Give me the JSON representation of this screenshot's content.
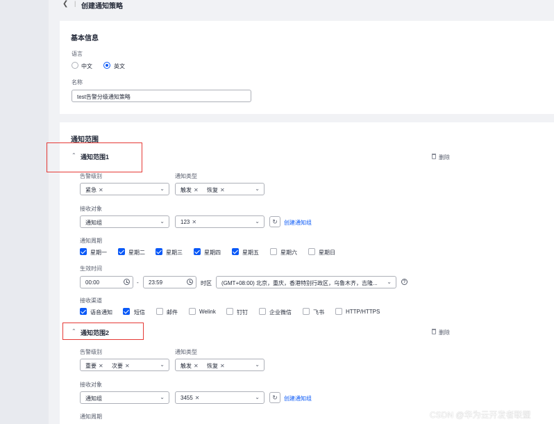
{
  "header": {
    "back_icon": "chevron-left-icon",
    "separator": "|",
    "title": "创建通知策略"
  },
  "basic": {
    "section_title": "基本信息",
    "language_label": "语言",
    "language_options": [
      "中文",
      "英文"
    ],
    "language_selected": "英文",
    "name_label": "名称",
    "name_value": "test告警分级通知策略"
  },
  "scope": {
    "section_title": "通知范围",
    "delete_label": "删除",
    "create_group_link": "创建通知组",
    "items": [
      {
        "title": "通知范围1",
        "alarm_level_label": "告警级别",
        "alarm_level_tags": [
          "紧急"
        ],
        "notify_type_label": "通知类型",
        "notify_type_tags": [
          "触发",
          "恢复"
        ],
        "receiver_label": "接收对象",
        "receiver_type": "通知组",
        "receiver_tags": [
          "123"
        ],
        "period_label": "通知周期",
        "period_days": [
          {
            "label": "星期一",
            "checked": true
          },
          {
            "label": "星期二",
            "checked": true
          },
          {
            "label": "星期三",
            "checked": true
          },
          {
            "label": "星期四",
            "checked": true
          },
          {
            "label": "星期五",
            "checked": true
          },
          {
            "label": "星期六",
            "checked": false
          },
          {
            "label": "星期日",
            "checked": false
          }
        ],
        "effective_label": "生效时间",
        "start_time": "00:00",
        "dash": "-",
        "end_time": "23:59",
        "timezone_label": "时区",
        "timezone_value": "(GMT+08:00) 北京，重庆，香港特别行政区，乌鲁木齐，吉隆...",
        "channel_label": "接收渠道",
        "channels": [
          {
            "label": "语音通知",
            "checked": true
          },
          {
            "label": "短信",
            "checked": true
          },
          {
            "label": "邮件",
            "checked": false
          },
          {
            "label": "Welink",
            "checked": false
          },
          {
            "label": "钉钉",
            "checked": false
          },
          {
            "label": "企业微信",
            "checked": false
          },
          {
            "label": "飞书",
            "checked": false
          },
          {
            "label": "HTTP/HTTPS",
            "checked": false
          }
        ]
      },
      {
        "title": "通知范围2",
        "alarm_level_label": "告警级别",
        "alarm_level_tags": [
          "重要",
          "次要"
        ],
        "notify_type_label": "通知类型",
        "notify_type_tags": [
          "触发",
          "恢复"
        ],
        "receiver_label": "接收对象",
        "receiver_type": "通知组",
        "receiver_tags": [
          "3455"
        ],
        "period_label": "通知周期"
      }
    ]
  },
  "watermark": "CSDN @华为云开发者联盟",
  "colors": {
    "primary": "#0a59f7",
    "annotation": "#e53935",
    "page_bg": "#f1f2f5"
  }
}
